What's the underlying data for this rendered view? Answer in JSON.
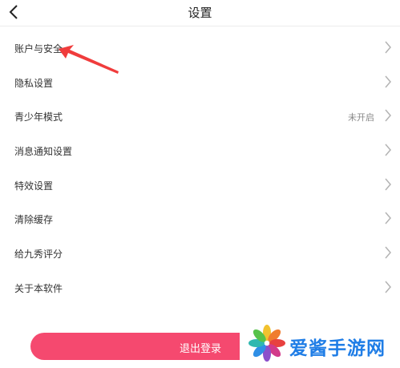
{
  "header": {
    "title": "设置",
    "back_icon": "chevron-left-icon"
  },
  "settings": {
    "items": [
      {
        "label": "账户与安全",
        "status": ""
      },
      {
        "label": "隐私设置",
        "status": ""
      },
      {
        "label": "青少年模式",
        "status": "未开启"
      },
      {
        "label": "消息通知设置",
        "status": ""
      },
      {
        "label": "特效设置",
        "status": ""
      },
      {
        "label": "清除缓存",
        "status": ""
      },
      {
        "label": "给九秀评分",
        "status": ""
      },
      {
        "label": "关于本软件",
        "status": ""
      }
    ],
    "chevron_icon": "chevron-right-icon"
  },
  "logout": {
    "label": "退出登录",
    "color": "#f5496f"
  },
  "watermark": {
    "text": "爱酱手游网",
    "color": "#1f7de6"
  },
  "annotation": {
    "arrow_color": "#f03c3c"
  }
}
